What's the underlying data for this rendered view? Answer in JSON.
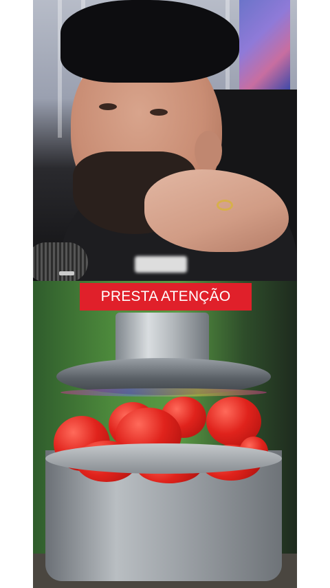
{
  "caption": {
    "text": "PRESTA ATENÇÃO",
    "background": "#e0202a",
    "color": "#ffffff"
  },
  "panels": {
    "top": {
      "icon": "podcast-host-video"
    },
    "bottom": {
      "icon": "hydraulic-press-tomatoes-video"
    }
  }
}
